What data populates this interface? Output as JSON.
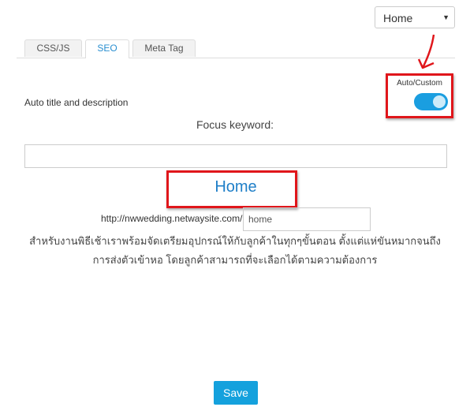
{
  "page_select": {
    "value": "Home"
  },
  "tabs": [
    {
      "label": "CSS/JS",
      "active": false
    },
    {
      "label": "SEO",
      "active": true
    },
    {
      "label": "Meta Tag",
      "active": false
    }
  ],
  "seo": {
    "auto_title_label": "Auto title and description",
    "auto_custom_label": "Auto/Custom",
    "toggle_on": true,
    "focus_keyword_label": "Focus keyword:",
    "focus_keyword_value": "",
    "page_heading": "Home",
    "url_prefix": "http://nwwedding.netwaysite.com/",
    "slug_value": "home",
    "description": "สำหรับงานพิธีเช้าเราพร้อมจัดเตรียมอุปกรณ์ให้กับลูกค้าในทุกๆขั้นตอน ตั้งแต่แห่ขันหมากจนถึงการส่งตัวเข้าหอ โดยลูกค้าสามารถที่จะเลือกได้ตามความต้องการ"
  },
  "actions": {
    "save_label": "Save"
  },
  "colors": {
    "accent": "#14a1dd",
    "highlight": "#e0161b",
    "tab_active_text": "#2a8fd0"
  }
}
